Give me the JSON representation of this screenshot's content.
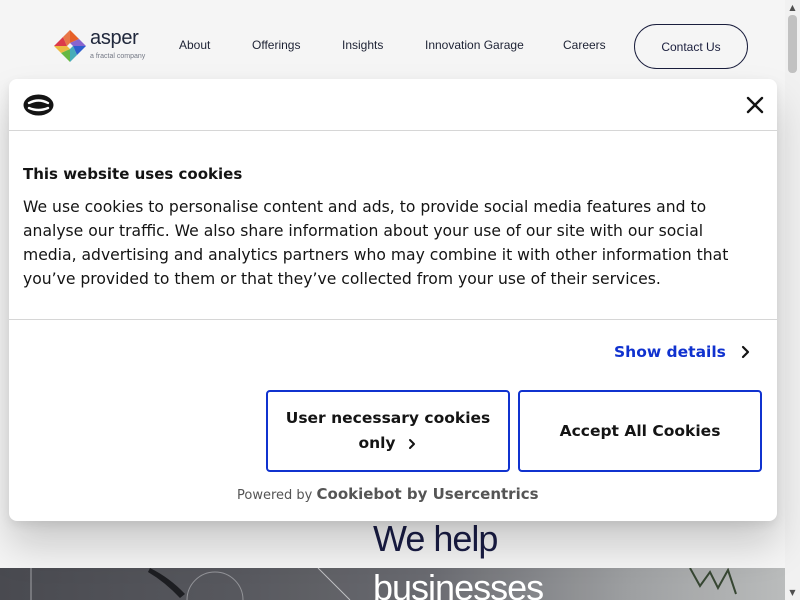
{
  "site": {
    "logo": {
      "name": "asper",
      "tagline": "a fractal company"
    },
    "nav": [
      "About",
      "Offerings",
      "Insights",
      "Innovation Garage",
      "Careers"
    ],
    "contact_label": "Contact Us",
    "hero": {
      "line1": "We help",
      "line2": "businesses"
    }
  },
  "cookie_dialog": {
    "title": "This website uses cookies",
    "body": "We use cookies to personalise content and ads, to provide social media features and to analyse our traffic. We also share information about your use of our site with our social media, advertising and analytics partners who may combine it with other information that you’ve provided to them or that they’ve collected from your use of their services.",
    "show_details": "Show details",
    "necessary_label": "User necessary cookies only",
    "accept_label": "Accept All Cookies",
    "powered_prefix": "Powered by",
    "powered_brand": "Cookiebot by Usercentrics"
  },
  "colors": {
    "accent": "#1032cf",
    "text": "#141414",
    "site_text": "#1c2040",
    "logo_orange": "#f0642a",
    "logo_blue": "#2f62d6",
    "logo_green": "#6bbf45",
    "logo_red": "#e53c4e"
  },
  "icons": {
    "logo": "asper-logo-icon",
    "cookiebot": "cookiebot-logo-icon",
    "close": "close-icon",
    "chevron": "chevron-right-icon"
  }
}
